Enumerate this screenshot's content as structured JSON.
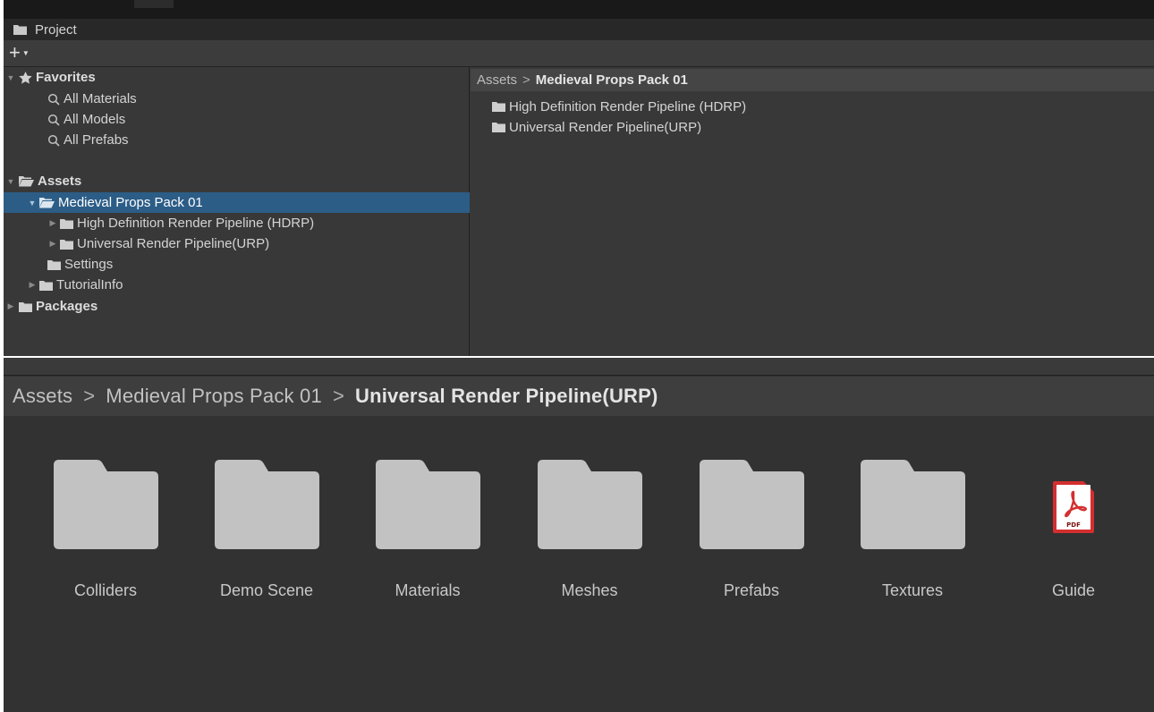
{
  "window": {
    "tab_title": "Project",
    "add_button_label": "+"
  },
  "tree": {
    "favorites": {
      "label": "Favorites",
      "items": [
        "All Materials",
        "All Models",
        "All Prefabs"
      ]
    },
    "assets": {
      "label": "Assets",
      "selected": "Medieval Props Pack 01",
      "children": [
        "High Definition Render Pipeline (HDRP)",
        "Universal Render Pipeline(URP)"
      ],
      "other": [
        "Settings",
        "TutorialInfo"
      ]
    },
    "packages": {
      "label": "Packages"
    }
  },
  "list_view": {
    "breadcrumb": {
      "root": "Assets",
      "current": "Medieval Props Pack 01",
      "separator": ">"
    },
    "items": [
      "High Definition Render Pipeline (HDRP)",
      "Universal Render Pipeline(URP)"
    ]
  },
  "grid_view": {
    "breadcrumb": {
      "root": "Assets",
      "middle": "Medieval Props Pack 01",
      "current": "Universal Render Pipeline(URP)",
      "separator": ">"
    },
    "items": [
      {
        "label": "Colliders",
        "icon": "folder-icon"
      },
      {
        "label": "Demo Scene",
        "icon": "folder-icon"
      },
      {
        "label": "Materials",
        "icon": "folder-icon"
      },
      {
        "label": "Meshes",
        "icon": "folder-icon"
      },
      {
        "label": "Prefabs",
        "icon": "folder-icon"
      },
      {
        "label": "Textures",
        "icon": "folder-icon"
      },
      {
        "label": "Guide",
        "icon": "pdf-icon"
      }
    ]
  },
  "colors": {
    "selection": "#2c5d87",
    "panel_bg": "#383838",
    "grid_bg": "#323232",
    "folder_icon": "#c2c2c2",
    "pdf_red": "#d32f2f"
  }
}
